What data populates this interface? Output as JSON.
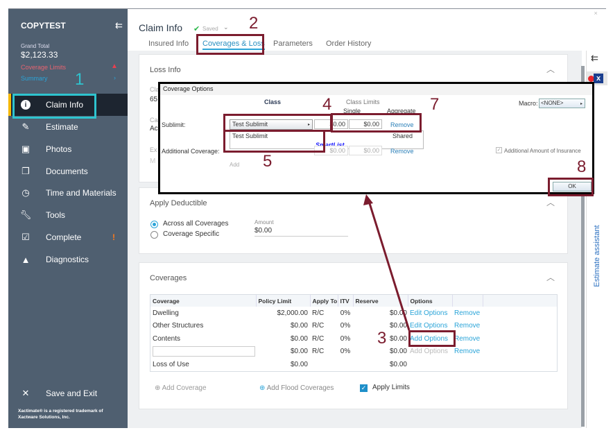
{
  "sidebar": {
    "title": "COPYTEST",
    "grand_total_label": "Grand Total",
    "grand_total": "$2,123.33",
    "coverage_limits": "Coverage Limits",
    "summary": "Summary",
    "items": [
      {
        "label": "Claim Info",
        "icon": "info-icon"
      },
      {
        "label": "Estimate",
        "icon": "pencil-icon"
      },
      {
        "label": "Photos",
        "icon": "photo-icon"
      },
      {
        "label": "Documents",
        "icon": "documents-icon"
      },
      {
        "label": "Time and Materials",
        "icon": "clock-icon"
      },
      {
        "label": "Tools",
        "icon": "wrench-icon"
      },
      {
        "label": "Complete",
        "icon": "clipboard-check-icon"
      },
      {
        "label": "Diagnostics",
        "icon": "warning-icon"
      }
    ],
    "save_exit": "Save and Exit",
    "trademark": "Xactimate® is a registered trademark of Xactware Solutions, Inc."
  },
  "header": {
    "title": "Claim Info",
    "status": "Saved",
    "tabs": [
      "Insured Info",
      "Coverages & Loss",
      "Parameters",
      "Order History"
    ],
    "active_tab": 1
  },
  "loss_info": {
    "title": "Loss Info",
    "frag1": "Cla",
    "frag2": "65",
    "frag3": "Ca",
    "frag4": "Ac",
    "frag5": "Ex",
    "frag6": "M"
  },
  "deductible": {
    "title": "Apply Deductible",
    "options": [
      "Across all Coverages",
      "Coverage Specific"
    ],
    "amount_label": "Amount",
    "amount": "$0.00"
  },
  "coverages": {
    "title": "Coverages",
    "columns": [
      "Coverage",
      "Policy Limit",
      "Apply To",
      "ITV",
      "Reserve",
      "Options"
    ],
    "rows": [
      {
        "coverage": "Dwelling",
        "limit": "$2,000.00",
        "apply": "R/C",
        "itv": "0%",
        "reserve": "$0.00",
        "option": "Edit Options",
        "remove": "Remove"
      },
      {
        "coverage": "Other Structures",
        "limit": "$0.00",
        "apply": "R/C",
        "itv": "0%",
        "reserve": "$0.00",
        "option": "Edit Options",
        "remove": "Remove"
      },
      {
        "coverage": "Contents",
        "limit": "$0.00",
        "apply": "R/C",
        "itv": "0%",
        "reserve": "$0.00",
        "option": "Add Options",
        "remove": "Remove"
      },
      {
        "coverage": "",
        "limit": "$0.00",
        "apply": "R/C",
        "itv": "0%",
        "reserve": "$0.00",
        "option": "Add Options",
        "remove": "Remove"
      },
      {
        "coverage": "Loss of Use",
        "limit": "$0.00",
        "apply": "",
        "itv": "",
        "reserve": "$0.00",
        "option": "",
        "remove": ""
      }
    ],
    "add_coverage": "Add Coverage",
    "add_flood": "Add Flood Coverages",
    "apply_limits": "Apply Limits"
  },
  "dialog": {
    "title": "Coverage Options",
    "class_header": "Class",
    "limits_header": "Class Limits",
    "single": "Single",
    "aggregate": "Aggregate",
    "macro_label": "Macro:",
    "macro_value": "<NONE>",
    "sublimit_label": "Sublimit:",
    "sublimit_value": "Test Sublimit",
    "sublimit_single": "$0.00",
    "sublimit_aggregate": "$0.00",
    "remove": "Remove",
    "dropdown_item": "Test Sublimit",
    "dropdown_shared": "Shared",
    "smartlist": "SmartList",
    "additional_label": "Additional Coverage:",
    "add_single": "$0.00",
    "add_aggregate": "$0.00",
    "add_remove": "Remove",
    "additional_amount": "Additional Amount of Insurance",
    "add": "Add",
    "ok": "OK"
  },
  "right_panel": {
    "label": "Estimate assistant"
  },
  "annotations": [
    "1",
    "2",
    "3",
    "4",
    "5",
    "7",
    "8"
  ],
  "colors": {
    "annotation": "#7b1c2e",
    "highlight": "#2ec4cf",
    "sidebar": "#4f5f70",
    "accent": "#2aa4d8"
  }
}
